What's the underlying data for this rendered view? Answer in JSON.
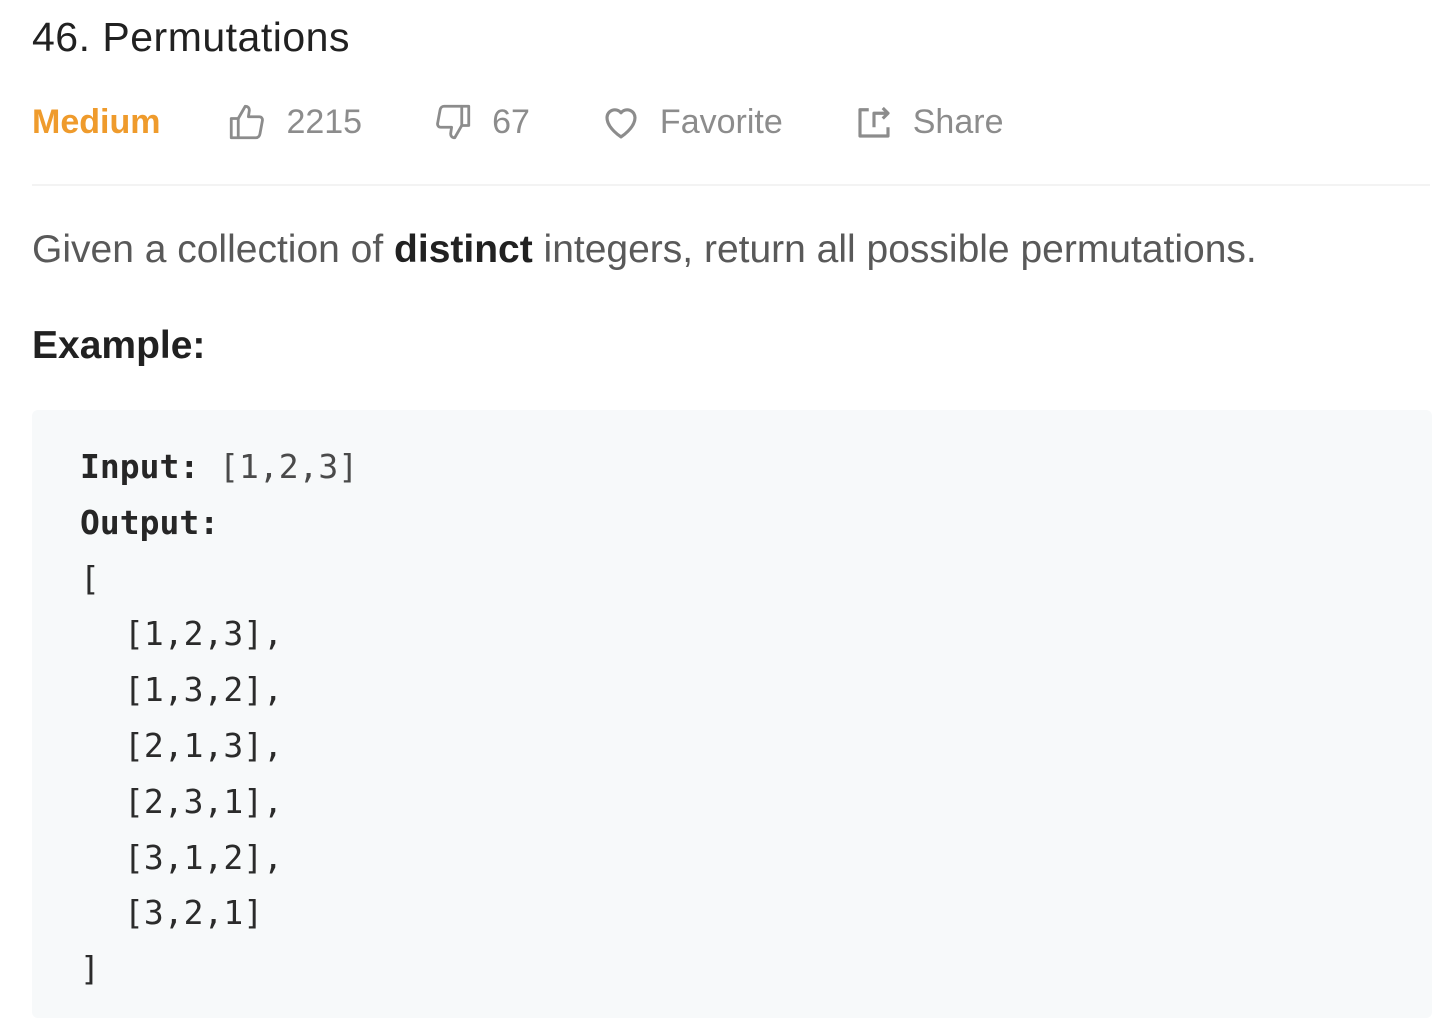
{
  "problem": {
    "title": "46. Permutations",
    "difficulty": "Medium",
    "likes": "2215",
    "dislikes": "67",
    "favorite_label": "Favorite",
    "share_label": "Share"
  },
  "description": {
    "before": "Given a collection of ",
    "emphasis": "distinct",
    "after": " integers, return all possible permutations."
  },
  "example": {
    "heading": "Example:",
    "input_label": "Input:",
    "input_value": " [1,2,3]",
    "output_label": "Output:",
    "open_bracket": "[",
    "rows": [
      "[1,2,3],",
      "[1,3,2],",
      "[2,1,3],",
      "[2,3,1],",
      "[3,1,2],",
      "[3,2,1]"
    ],
    "close_bracket": "]"
  },
  "colors": {
    "difficulty_medium": "#ef9b2c",
    "muted_text": "#8c8c8c",
    "code_background": "#f7f9fa"
  },
  "icons": {
    "like": "thumbs-up-icon",
    "dislike": "thumbs-down-icon",
    "favorite": "heart-icon",
    "share": "share-icon"
  }
}
